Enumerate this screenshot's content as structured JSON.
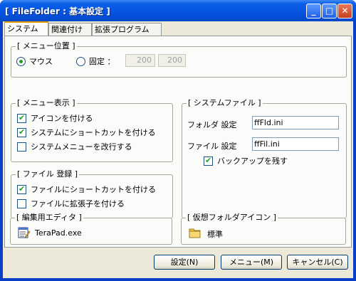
{
  "window": {
    "title": "[ FileFolder : 基本設定 ]",
    "controls": {
      "minimize": "_",
      "maximize": "□",
      "close": "✕"
    }
  },
  "tabs": [
    {
      "label": "システム",
      "active": true
    },
    {
      "label": "関連付け",
      "active": false
    },
    {
      "label": "拡張プログラム",
      "active": false
    }
  ],
  "menu_position": {
    "title": "[ メニュー位置 ]",
    "option_mouse": "マウス",
    "option_fixed": "固定 ：",
    "selected": "mouse",
    "x_value": "200",
    "y_value": "200"
  },
  "menu_display": {
    "title": "[ メニュー表示 ]",
    "items": [
      {
        "label": "アイコンを付ける",
        "checked": true
      },
      {
        "label": "システムにショートカットを付ける",
        "checked": true
      },
      {
        "label": "システムメニューを改行する",
        "checked": false
      }
    ]
  },
  "file_register": {
    "title": "[ ファイル 登録 ]",
    "items": [
      {
        "label": "ファイルにショートカットを付ける",
        "checked": true
      },
      {
        "label": "ファイルに拡張子を付ける",
        "checked": false
      }
    ]
  },
  "system_file": {
    "title": "[ システムファイル ]",
    "folder_label": "フォルダ 設定",
    "folder_value": "ffFld.ini",
    "file_label": "ファイル 設定",
    "file_value": "ffFil.ini",
    "backup_label": "バックアップを残す",
    "backup_checked": true
  },
  "editor": {
    "title": "[ 編集用エディタ ]",
    "name": "TeraPad.exe",
    "icon": "notepad-icon"
  },
  "virtual_folder": {
    "title": "[ 仮想フォルダアイコン ]",
    "name": "標準",
    "icon": "folder-icon"
  },
  "buttons": {
    "settings": "設定(N)",
    "menu": "メニュー(M)",
    "cancel": "キャンセル(C)"
  },
  "colors": {
    "titlebar": "#0554e0",
    "dialog_bg": "#ece9d8",
    "panel_bg": "#fbfbf9",
    "check_mark": "#21a121"
  }
}
